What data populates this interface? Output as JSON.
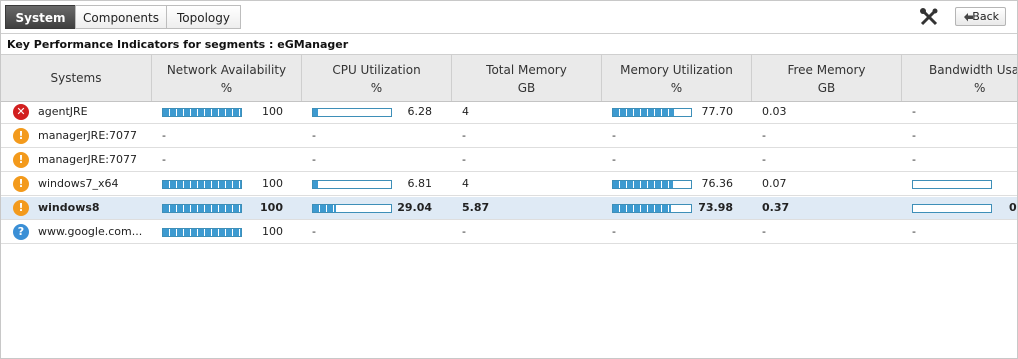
{
  "tabs": [
    {
      "label": "System",
      "active": true
    },
    {
      "label": "Components",
      "active": false
    },
    {
      "label": "Topology",
      "active": false
    }
  ],
  "toolbar": {
    "tools_icon": "tools-icon",
    "back_label": "Back",
    "back_icon": "back-arrow-icon"
  },
  "kpi_title": "Key Performance Indicators for segments : eGManager",
  "columns": [
    {
      "name": "Systems",
      "unit": ""
    },
    {
      "name": "Network Availability",
      "unit": "%"
    },
    {
      "name": "CPU Utilization",
      "unit": "%"
    },
    {
      "name": "Total Memory",
      "unit": "GB"
    },
    {
      "name": "Memory Utilization",
      "unit": "%"
    },
    {
      "name": "Free Memory",
      "unit": "GB"
    },
    {
      "name": "Bandwidth Usa",
      "unit": "%"
    }
  ],
  "colors": {
    "critical": "#d21f1f",
    "major": "#f39a1c",
    "unknown": "#3a8fd6",
    "bar": "#3d9ad0",
    "selected_row": "#dfeaf5"
  },
  "rows": [
    {
      "system": "agentJRE",
      "status": "critical",
      "status_glyph": "✕",
      "net_avail": "100",
      "cpu": "6.28",
      "total_mem": "4",
      "mem_util": "77.70",
      "free_mem": "0.03",
      "bandwidth": "-",
      "net_avail_pct": 100,
      "cpu_pct": 6.28,
      "mem_util_pct": 77.7,
      "bandwidth_pct": null,
      "selected": false
    },
    {
      "system": "managerJRE:7077",
      "status": "major",
      "status_glyph": "!",
      "net_avail": "-",
      "cpu": "-",
      "total_mem": "-",
      "mem_util": "-",
      "free_mem": "-",
      "bandwidth": "-",
      "net_avail_pct": null,
      "cpu_pct": null,
      "mem_util_pct": null,
      "bandwidth_pct": null,
      "selected": false
    },
    {
      "system": "managerJRE:7077",
      "status": "major",
      "status_glyph": "!",
      "net_avail": "-",
      "cpu": "-",
      "total_mem": "-",
      "mem_util": "-",
      "free_mem": "-",
      "bandwidth": "-",
      "net_avail_pct": null,
      "cpu_pct": null,
      "mem_util_pct": null,
      "bandwidth_pct": null,
      "selected": false
    },
    {
      "system": "windows7_x64",
      "status": "major",
      "status_glyph": "!",
      "net_avail": "100",
      "cpu": "6.81",
      "total_mem": "4",
      "mem_util": "76.36",
      "free_mem": "0.07",
      "bandwidth": "",
      "net_avail_pct": 100,
      "cpu_pct": 6.81,
      "mem_util_pct": 76.36,
      "bandwidth_pct": 0,
      "selected": false
    },
    {
      "system": "windows8",
      "status": "major",
      "status_glyph": "!",
      "net_avail": "100",
      "cpu": "29.04",
      "total_mem": "5.87",
      "mem_util": "73.98",
      "free_mem": "0.37",
      "bandwidth": "0",
      "net_avail_pct": 100,
      "cpu_pct": 29.04,
      "mem_util_pct": 73.98,
      "bandwidth_pct": 0,
      "selected": true
    },
    {
      "system": "www.google.com...",
      "status": "unknown",
      "status_glyph": "?",
      "net_avail": "100",
      "cpu": "-",
      "total_mem": "-",
      "mem_util": "-",
      "free_mem": "-",
      "bandwidth": "-",
      "net_avail_pct": 100,
      "cpu_pct": null,
      "mem_util_pct": null,
      "bandwidth_pct": null,
      "selected": false
    }
  ]
}
